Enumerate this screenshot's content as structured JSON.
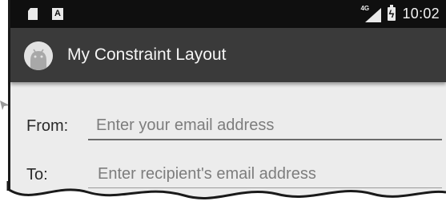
{
  "status_bar": {
    "network_label": "4G",
    "time": "10:02",
    "left_icons": [
      "sd-card-icon",
      "a-notification-icon"
    ],
    "right_icons": [
      "signal-icon",
      "battery-charging-icon"
    ]
  },
  "app_bar": {
    "title": "My Constraint Layout",
    "icon": "android-app-icon",
    "color": "#3a3a3a"
  },
  "form": {
    "from": {
      "label": "From:",
      "placeholder": "Enter your email address",
      "value": ""
    },
    "to": {
      "label": "To:",
      "placeholder": "Enter recipient's email address",
      "value": ""
    }
  },
  "colors": {
    "status_bar": "#0f0f0f",
    "app_bar": "#3a3a3a",
    "background": "#ececec"
  }
}
